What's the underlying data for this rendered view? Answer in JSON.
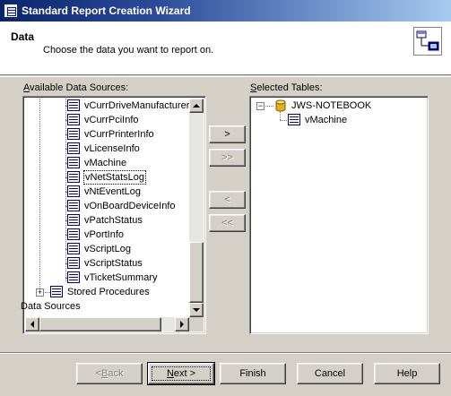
{
  "window": {
    "title": "Standard Report Creation Wizard"
  },
  "header": {
    "title": "Data",
    "subtitle": "Choose the data you want to report on."
  },
  "available": {
    "label_prefix": "A",
    "label_rest": "vailable Data Sources:",
    "items": [
      "vCurrDriveManufacturer",
      "vCurrPciInfo",
      "vCurrPrinterInfo",
      "vLicenseInfo",
      "vMachine",
      "vNetStatsLog",
      "vNtEventLog",
      "vOnBoardDeviceInfo",
      "vPatchStatus",
      "vPortInfo",
      "vScriptLog",
      "vScriptStatus",
      "vTicketSummary"
    ],
    "selected_index": 5,
    "stored_procedures": "Stored Procedures",
    "data_sources": "Data Sources"
  },
  "transfer": {
    "add": ">",
    "add_all": ">>",
    "remove": "<",
    "remove_all": "<<"
  },
  "selected": {
    "label_prefix": "S",
    "label_rest": "elected Tables:",
    "server": "JWS-NOTEBOOK",
    "tables": [
      "vMachine"
    ]
  },
  "footer": {
    "back_prefix": "< ",
    "back_key": "B",
    "back_rest": "ack",
    "next_prefix": "",
    "next_key": "N",
    "next_rest": "ext >",
    "finish": "Finish",
    "cancel": "Cancel",
    "help": "Help"
  },
  "colors": {
    "title_start": "#0a246a",
    "title_end": "#a6caf0",
    "face": "#d4d0c8"
  },
  "icons": {
    "title": "window-icon",
    "header": "wizard-icon",
    "table": "table-icon",
    "database": "database-icon"
  }
}
